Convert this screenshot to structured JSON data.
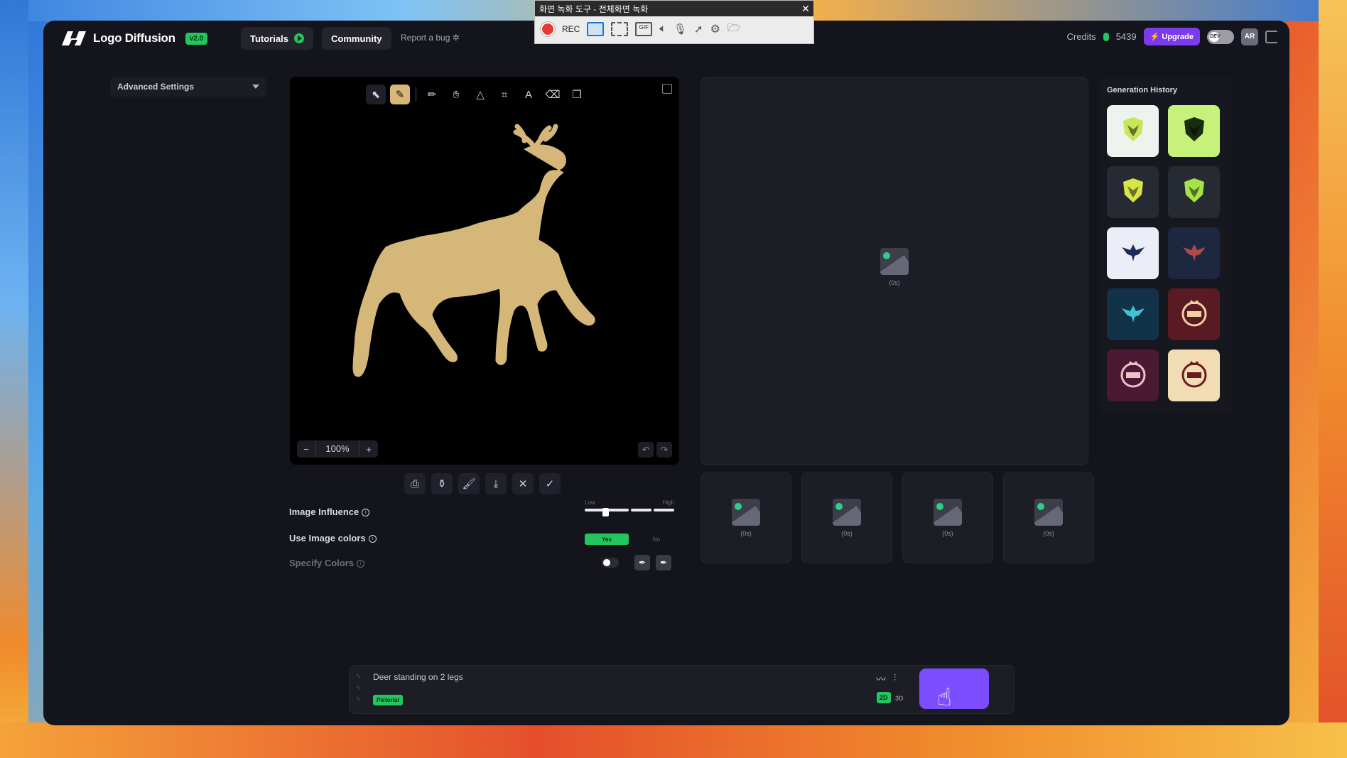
{
  "recorder": {
    "title": "화면 녹화 도구 - 전체화면 녹화",
    "rec_label": "REC",
    "close_icon": "close-icon"
  },
  "app": {
    "name": "Logo Diffusion",
    "version": "v2.0",
    "nav": {
      "tutorials": "Tutorials",
      "community": "Community",
      "report": "Report a bug"
    },
    "credits_label": "Credits",
    "credits_value": "5439",
    "upgrade": "Upgrade",
    "dev_toggle": "DEV",
    "avatar": "AR"
  },
  "settings": {
    "advanced": "Advanced Settings",
    "image_influence": "Image Influence",
    "slider_low": "Low",
    "slider_high": "High",
    "image_influence_level": 0.2,
    "use_image_colors": "Use Image colors",
    "yes": "Yes",
    "no": "No",
    "specify_colors": "Specify Colors"
  },
  "canvas": {
    "zoom": "100%",
    "zoom_minus": "−",
    "zoom_plus": "+"
  },
  "preview": {
    "main_label": "(0s)",
    "thumbs": [
      "(0s)",
      "(0s)",
      "(0s)",
      "(0s)"
    ]
  },
  "history": {
    "title": "Generation History",
    "items": [
      {
        "bg": "#eef3ee",
        "fg": "#c7e65a",
        "icon": "shield-eagle-icon"
      },
      {
        "bg": "#c6f27a",
        "fg": "#1b2b10",
        "icon": "shield-eagle-icon"
      },
      {
        "bg": "#262a33",
        "fg": "#d5e54a",
        "icon": "shield-eagle-icon"
      },
      {
        "bg": "#262a33",
        "fg": "#a6e34a",
        "icon": "shield-eagle-icon"
      },
      {
        "bg": "#eceef7",
        "fg": "#1e2a5a",
        "icon": "eagle-icon"
      },
      {
        "bg": "#1d2740",
        "fg": "#b04a4a",
        "icon": "eagle-icon"
      },
      {
        "bg": "#12324a",
        "fg": "#3fc4d6",
        "icon": "eagle-icon"
      },
      {
        "bg": "#5a1a24",
        "fg": "#f0d0a0",
        "icon": "royal-badge-icon"
      },
      {
        "bg": "#4a1a32",
        "fg": "#f0c0c8",
        "icon": "royal-badge-icon"
      },
      {
        "bg": "#f2dcb3",
        "fg": "#6a1a22",
        "icon": "royal-badge-icon"
      }
    ]
  },
  "prompt": {
    "text": "Deer standing on 2 legs",
    "style_tag": "Pictorial",
    "mode_2d": "2D",
    "mode_3d": "3D"
  },
  "colors": {
    "accent_green": "#22c55e",
    "accent_purple": "#7c4dff",
    "sketch_fill": "#d6b77a"
  }
}
